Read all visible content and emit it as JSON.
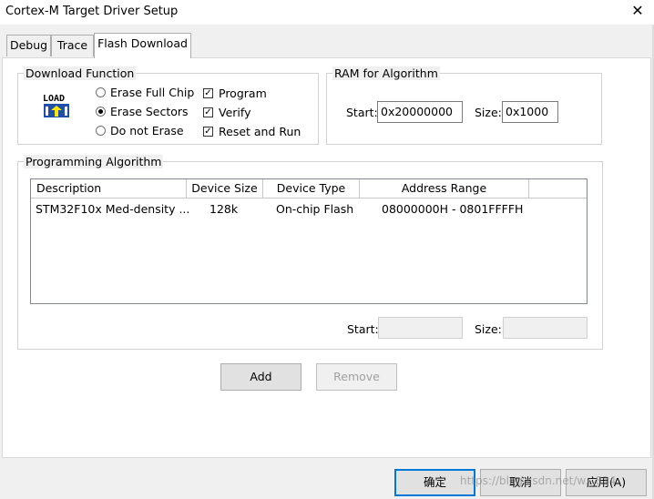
{
  "window": {
    "title": "Cortex-M Target Driver Setup",
    "close_glyph": "✕"
  },
  "tabs": [
    {
      "label": "Debug"
    },
    {
      "label": "Trace"
    },
    {
      "label": "Flash Download",
      "active": true
    }
  ],
  "download_function": {
    "label": "Download Function",
    "icon_text": "LOAD",
    "radios": [
      {
        "label": "Erase Full Chip",
        "selected": false
      },
      {
        "label": "Erase Sectors",
        "selected": true
      },
      {
        "label": "Do not Erase",
        "selected": false
      }
    ],
    "checks": [
      {
        "label": "Program",
        "checked": true
      },
      {
        "label": "Verify",
        "checked": true
      },
      {
        "label": "Reset and Run",
        "checked": true
      }
    ]
  },
  "ram": {
    "label": "RAM for Algorithm",
    "start_label": "Start:",
    "start_value": "0x20000000",
    "size_label": "Size:",
    "size_value": "0x1000"
  },
  "algorithm": {
    "label": "Programming Algorithm",
    "columns": [
      "Description",
      "Device Size",
      "Device Type",
      "Address Range"
    ],
    "rows": [
      {
        "description": "STM32F10x Med-density ...",
        "size": "128k",
        "type": "On-chip Flash",
        "range": "08000000H - 0801FFFFH"
      }
    ],
    "start_label": "Start:",
    "start_value": "",
    "size_label": "Size:",
    "size_value": ""
  },
  "buttons": {
    "add": "Add",
    "remove": "Remove"
  },
  "footer": {
    "ok": "确定",
    "cancel": "取消",
    "apply": "应用(A)"
  },
  "watermark": "https://blog.csdn.net/w...814"
}
